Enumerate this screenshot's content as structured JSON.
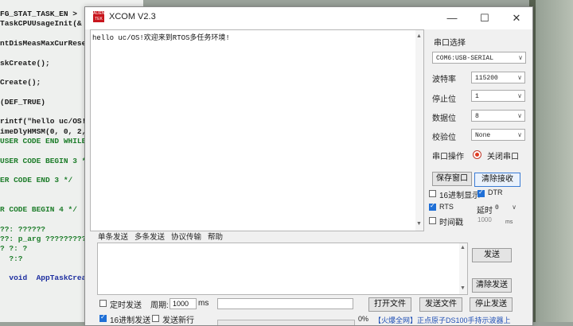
{
  "editor": {
    "lines": [
      {
        "text": "FG_STAT_TASK_EN >",
        "color": "blk"
      },
      {
        "text": "TaskCPUUsageInit(&",
        "color": "blk"
      },
      {
        "text": "",
        "color": "blk"
      },
      {
        "text": "ntDisMeasMaxCurRese",
        "color": "blk"
      },
      {
        "text": "",
        "color": "blk"
      },
      {
        "text": "skCreate();",
        "color": "blk"
      },
      {
        "text": "",
        "color": "blk"
      },
      {
        "text": "Create();",
        "color": "blk"
      },
      {
        "text": "",
        "color": "blk"
      },
      {
        "text": "(DEF_TRUE)",
        "color": "blk"
      },
      {
        "text": "",
        "color": "blk"
      },
      {
        "text": "rintf(\"hello uc/OS!",
        "color": "blk"
      },
      {
        "text": "imeDlyHMSM(0, 0, 2,",
        "color": "blk"
      },
      {
        "text": "USER CODE END WHILE",
        "color": "grn"
      },
      {
        "text": "",
        "color": "blk"
      },
      {
        "text": "USER CODE BEGIN 3 *",
        "color": "grn"
      },
      {
        "text": "",
        "color": "blk"
      },
      {
        "text": "ER CODE END 3 */",
        "color": "grn"
      },
      {
        "text": "",
        "color": "blk"
      },
      {
        "text": "",
        "color": "blk"
      },
      {
        "text": "R CODE BEGIN 4 */",
        "color": "grn"
      },
      {
        "text": "",
        "color": "blk"
      },
      {
        "text": "??: ??????",
        "color": "grn"
      },
      {
        "text": "??: p_arg ?????????",
        "color": "grn"
      },
      {
        "text": "? ?: ?",
        "color": "grn"
      },
      {
        "text": "  ?:?",
        "color": "grn"
      },
      {
        "text": "",
        "color": "blk"
      },
      {
        "text": "  void  AppTaskCreat",
        "color": "blu"
      }
    ]
  },
  "window": {
    "title": "XCOM V2.3",
    "logo_text": "ALIEN TEK",
    "controls": {
      "minimize": "—",
      "maximize": "☐",
      "close": "✕"
    }
  },
  "receive": {
    "text": "hello uc/OS!欢迎来到RTOS多任务环境!"
  },
  "settings": {
    "port_label": "串口选择",
    "port_value": "COM6:USB-SERIAL",
    "baud_label": "波特率",
    "baud_value": "115200",
    "stop_label": "停止位",
    "stop_value": "1",
    "data_label": "数据位",
    "data_value": "8",
    "parity_label": "校验位",
    "parity_value": "None",
    "op_label": "串口操作",
    "op_button": "关闭串口",
    "save_button": "保存窗口",
    "clear_rx_button": "清除接收",
    "hex_display_label": "16进制显示",
    "hex_display_checked": false,
    "dtr_label": "DTR",
    "dtr_checked": true,
    "rts_label": "RTS",
    "rts_checked": true,
    "delay_label": "延时",
    "delay_value": "0",
    "timestamp_label": "时间戳",
    "timestamp_checked": false,
    "timestamp_value": "1000",
    "timestamp_unit": "ms"
  },
  "tabs": [
    "单条发送",
    "多条发送",
    "协议传输",
    "帮助"
  ],
  "send": {
    "send_button": "发送",
    "clear_send_button": "清除发送"
  },
  "bottom": {
    "timed_send_label": "定时发送",
    "timed_send_checked": false,
    "period_label": "周期:",
    "period_value": "1000",
    "period_unit": "ms",
    "hex_send_label": "16进制发送",
    "hex_send_checked": true,
    "newline_label": "发送新行",
    "newline_checked": false,
    "open_file_button": "打开文件",
    "send_file_button": "发送文件",
    "stop_send_button": "停止发送",
    "progress_percent": "0%",
    "ad_link": "【火爆全网】正点原子DS100手持示波器上"
  }
}
